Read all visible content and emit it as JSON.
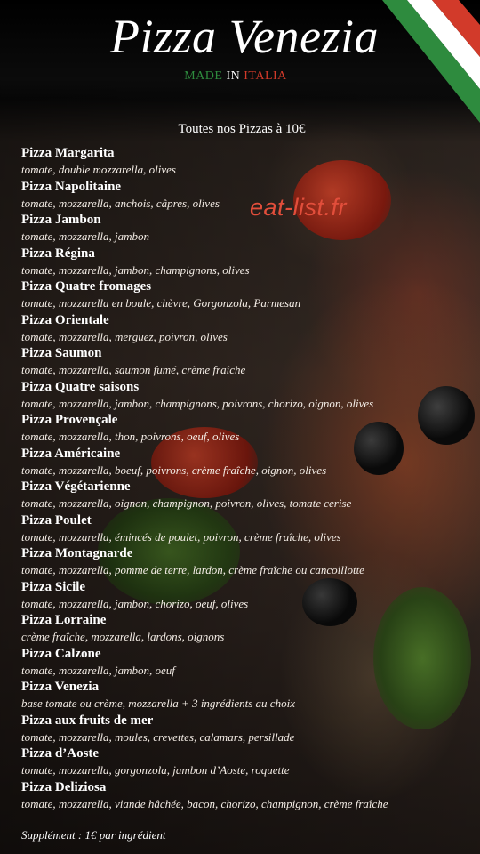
{
  "header": {
    "title": "Pizza Venezia",
    "tagline": {
      "made": "MADE",
      "in": " IN ",
      "italia": "ITALIA"
    }
  },
  "subheading": "Toutes nos Pizzas à 10€",
  "watermark": "eat-list.fr",
  "menu": [
    {
      "name": "Pizza Margarita",
      "desc": "tomate, double mozzarella, olives"
    },
    {
      "name": "Pizza Napolitaine",
      "desc": "tomate, mozzarella, anchois, câpres, olives"
    },
    {
      "name": "Pizza Jambon",
      "desc": "tomate, mozzarella, jambon"
    },
    {
      "name": "Pizza Régina",
      "desc": "tomate, mozzarella, jambon, champignons, olives"
    },
    {
      "name": "Pizza Quatre fromages",
      "desc": "tomate, mozzarella en boule, chèvre, Gorgonzola, Parmesan"
    },
    {
      "name": "Pizza Orientale",
      "desc": "tomate, mozzarella, merguez, poivron, olives"
    },
    {
      "name": "Pizza Saumon",
      "desc": "tomate, mozzarella, saumon fumé, crème fraîche"
    },
    {
      "name": "Pizza Quatre saisons",
      "desc": "tomate, mozzarella, jambon, champignons, poivrons, chorizo, oignon, olives"
    },
    {
      "name": "Pizza Provençale",
      "desc": "tomate, mozzarella, thon, poivrons, oeuf, olives"
    },
    {
      "name": "Pizza Américaine",
      "desc": "tomate, mozzarella, boeuf, poivrons, crème fraîche, oignon, olives"
    },
    {
      "name": "Pizza Végétarienne",
      "desc": "tomate, mozzarella, oignon, champignon, poivron, olives, tomate cerise"
    },
    {
      "name": "Pizza Poulet",
      "desc": "tomate, mozzarella, émincés de poulet, poivron, crème fraîche, olives"
    },
    {
      "name": "Pizza Montagnarde",
      "desc": "tomate, mozzarella, pomme de terre, lardon, crème fraîche ou cancoillotte"
    },
    {
      "name": "Pizza Sicile",
      "desc": "tomate, mozzarella, jambon, chorizo, oeuf, olives"
    },
    {
      "name": "Pizza Lorraine",
      "desc": "crème fraîche, mozzarella, lardons, oignons"
    },
    {
      "name": "Pizza Calzone",
      "desc": "tomate, mozzarella, jambon, oeuf"
    },
    {
      "name": "Pizza Venezia",
      "desc": "base tomate ou crème, mozzarella + 3 ingrédients au choix"
    },
    {
      "name": "Pizza aux fruits de mer",
      "desc": "tomate, mozzarella, moules, crevettes, calamars, persillade"
    },
    {
      "name": "Pizza d’Aoste",
      "desc": "tomate, mozzarella, gorgonzola, jambon d’Aoste, roquette"
    },
    {
      "name": "Pizza Deliziosa",
      "desc": "tomate, mozzarella, viande hâchée, bacon, chorizo, champignon, crème fraîche"
    }
  ],
  "supplement": "Supplément : 1€ par ingrédient",
  "colors": {
    "flag_green": "#2e8b3e",
    "flag_white": "#ffffff",
    "flag_red": "#d23a2a",
    "watermark": "#e24e3b"
  }
}
